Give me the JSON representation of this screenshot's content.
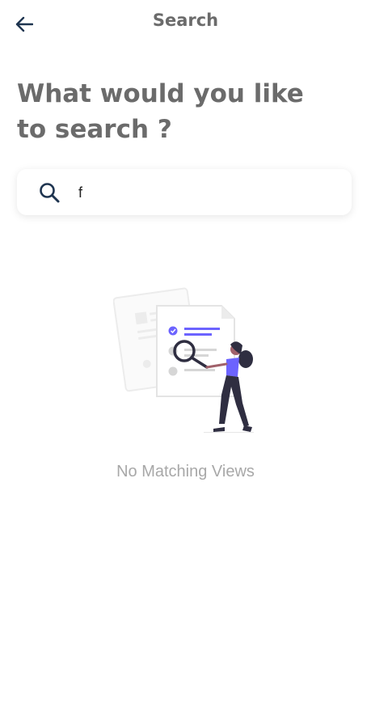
{
  "header": {
    "title": "Search",
    "back_icon": "arrow-left-icon"
  },
  "prompt": {
    "text": "What would you like to search ?"
  },
  "search": {
    "icon": "search-icon",
    "value": "f"
  },
  "empty_state": {
    "illustration": "searching-documents-illustration",
    "message": "No Matching Views"
  },
  "colors": {
    "accent": "#6c63ff",
    "heading": "#6b6b6b",
    "icon_dark": "#1f3550",
    "muted_text": "#a8a8a8"
  }
}
